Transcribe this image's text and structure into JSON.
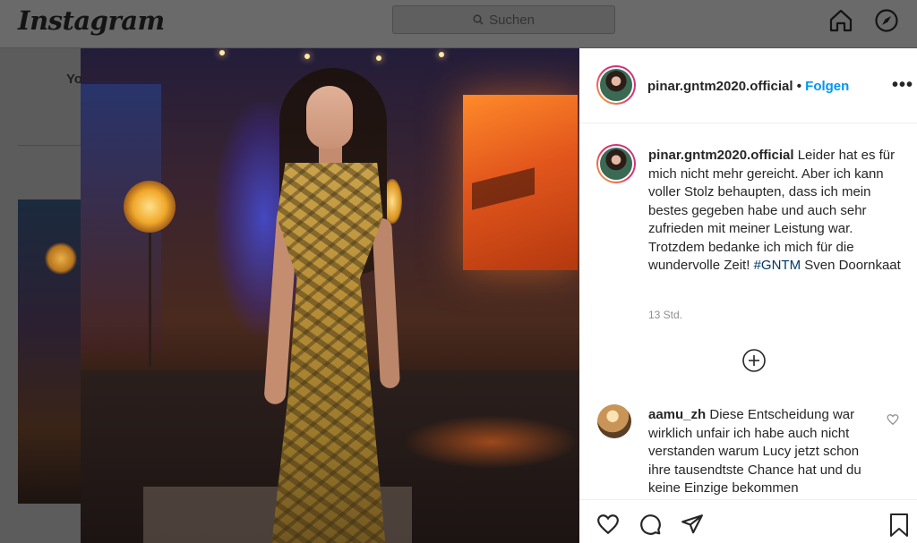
{
  "app": {
    "logo": "Instagram"
  },
  "topbar": {
    "search_placeholder": "Suchen"
  },
  "background_page": {
    "partial_text": "Yo"
  },
  "post": {
    "author": "pinar.gntm2020.official",
    "separator": "•",
    "follow_label": "Folgen",
    "more_label": "•••",
    "caption_text": " Leider hat es für mich nicht mehr gereicht. Aber ich kann voller Stolz behaupten, dass ich mein bestes gegeben habe und auch sehr zufrieden mit meiner Leistung war. Trotzdem bedanke ich mich für die wundervolle Zeit! ",
    "hashtag": "#GNTM",
    "caption_tail": " Sven Doornkaat",
    "timestamp": "13 Std."
  },
  "comments": [
    {
      "user": "aamu_zh",
      "text": " Diese Entscheidung war wirklich unfair ich habe auch nicht verstanden warum Lucy jetzt schon ihre tausendtste Chance hat und du keine Einzige bekommen"
    }
  ],
  "icons": {
    "home": "home-icon",
    "explore": "compass-icon",
    "search": "search-icon",
    "load_more": "plus-circle-icon",
    "like_comment": "heart-icon",
    "like": "heart-icon",
    "comment": "comment-icon",
    "share": "send-icon",
    "save": "bookmark-icon"
  },
  "colors": {
    "link_blue": "#0095f6",
    "hashtag": "#00376b",
    "meta_gray": "#8e8e8e"
  }
}
